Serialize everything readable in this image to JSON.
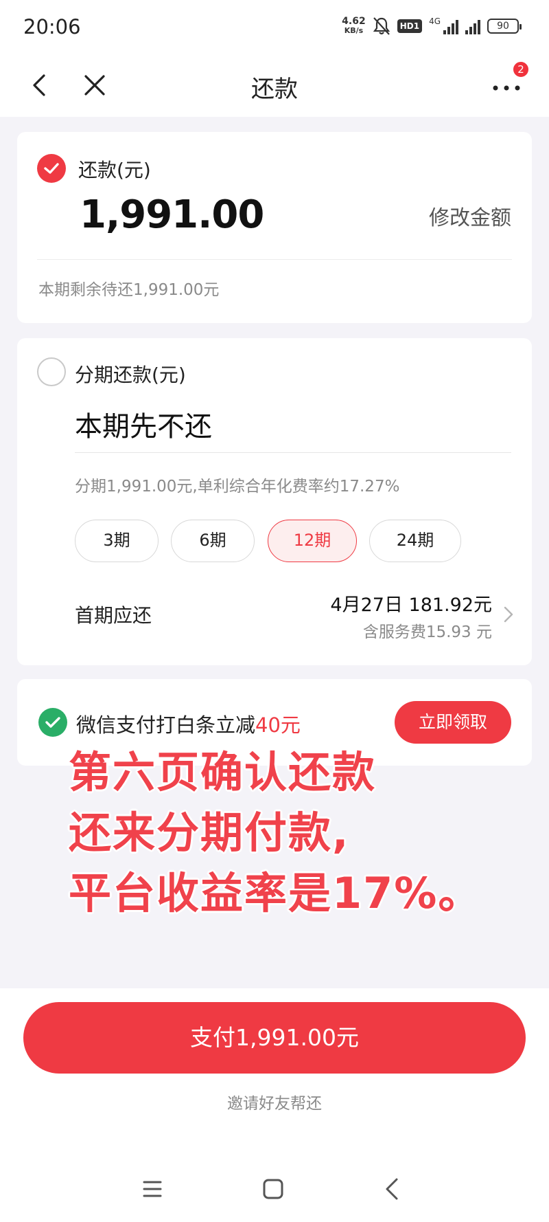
{
  "status_bar": {
    "time": "20:06",
    "net_speed_value": "4.62",
    "net_speed_unit": "KB/s",
    "hd_badge": "HD1",
    "network_type": "4G",
    "battery": "90"
  },
  "nav": {
    "title": "还款",
    "more_badge": "2"
  },
  "repay_card": {
    "label": "还款(元)",
    "amount": "1,991.00",
    "modify_label": "修改金额",
    "remaining_text": "本期剩余待还1,991.00元",
    "checked": true
  },
  "installment_card": {
    "label": "分期还款(元)",
    "defer_text": "本期先不还",
    "rate_text": "分期1,991.00元,单利综合年化费率约17.27%",
    "terms": [
      {
        "label": "3期",
        "selected": false
      },
      {
        "label": "6期",
        "selected": false
      },
      {
        "label": "12期",
        "selected": true
      },
      {
        "label": "24期",
        "selected": false
      }
    ],
    "first_label": "首期应还",
    "first_amount": "4月27日 181.92元",
    "service_fee": "含服务费15.93 元",
    "checked": false
  },
  "promo": {
    "text": "微信支付打白条立减",
    "highlight": "40元",
    "button_label": "立即领取"
  },
  "overlay_caption": {
    "lines": [
      "第六页确认还款",
      "还来分期付款,",
      "平台收益率是17%。"
    ]
  },
  "bottom": {
    "pay_button": "支付1,991.00元",
    "invite_link": "邀请好友帮还"
  },
  "colors": {
    "accent": "#ef3a43",
    "wechat_green": "#2aae67",
    "page_bg": "#f4f3f8"
  }
}
